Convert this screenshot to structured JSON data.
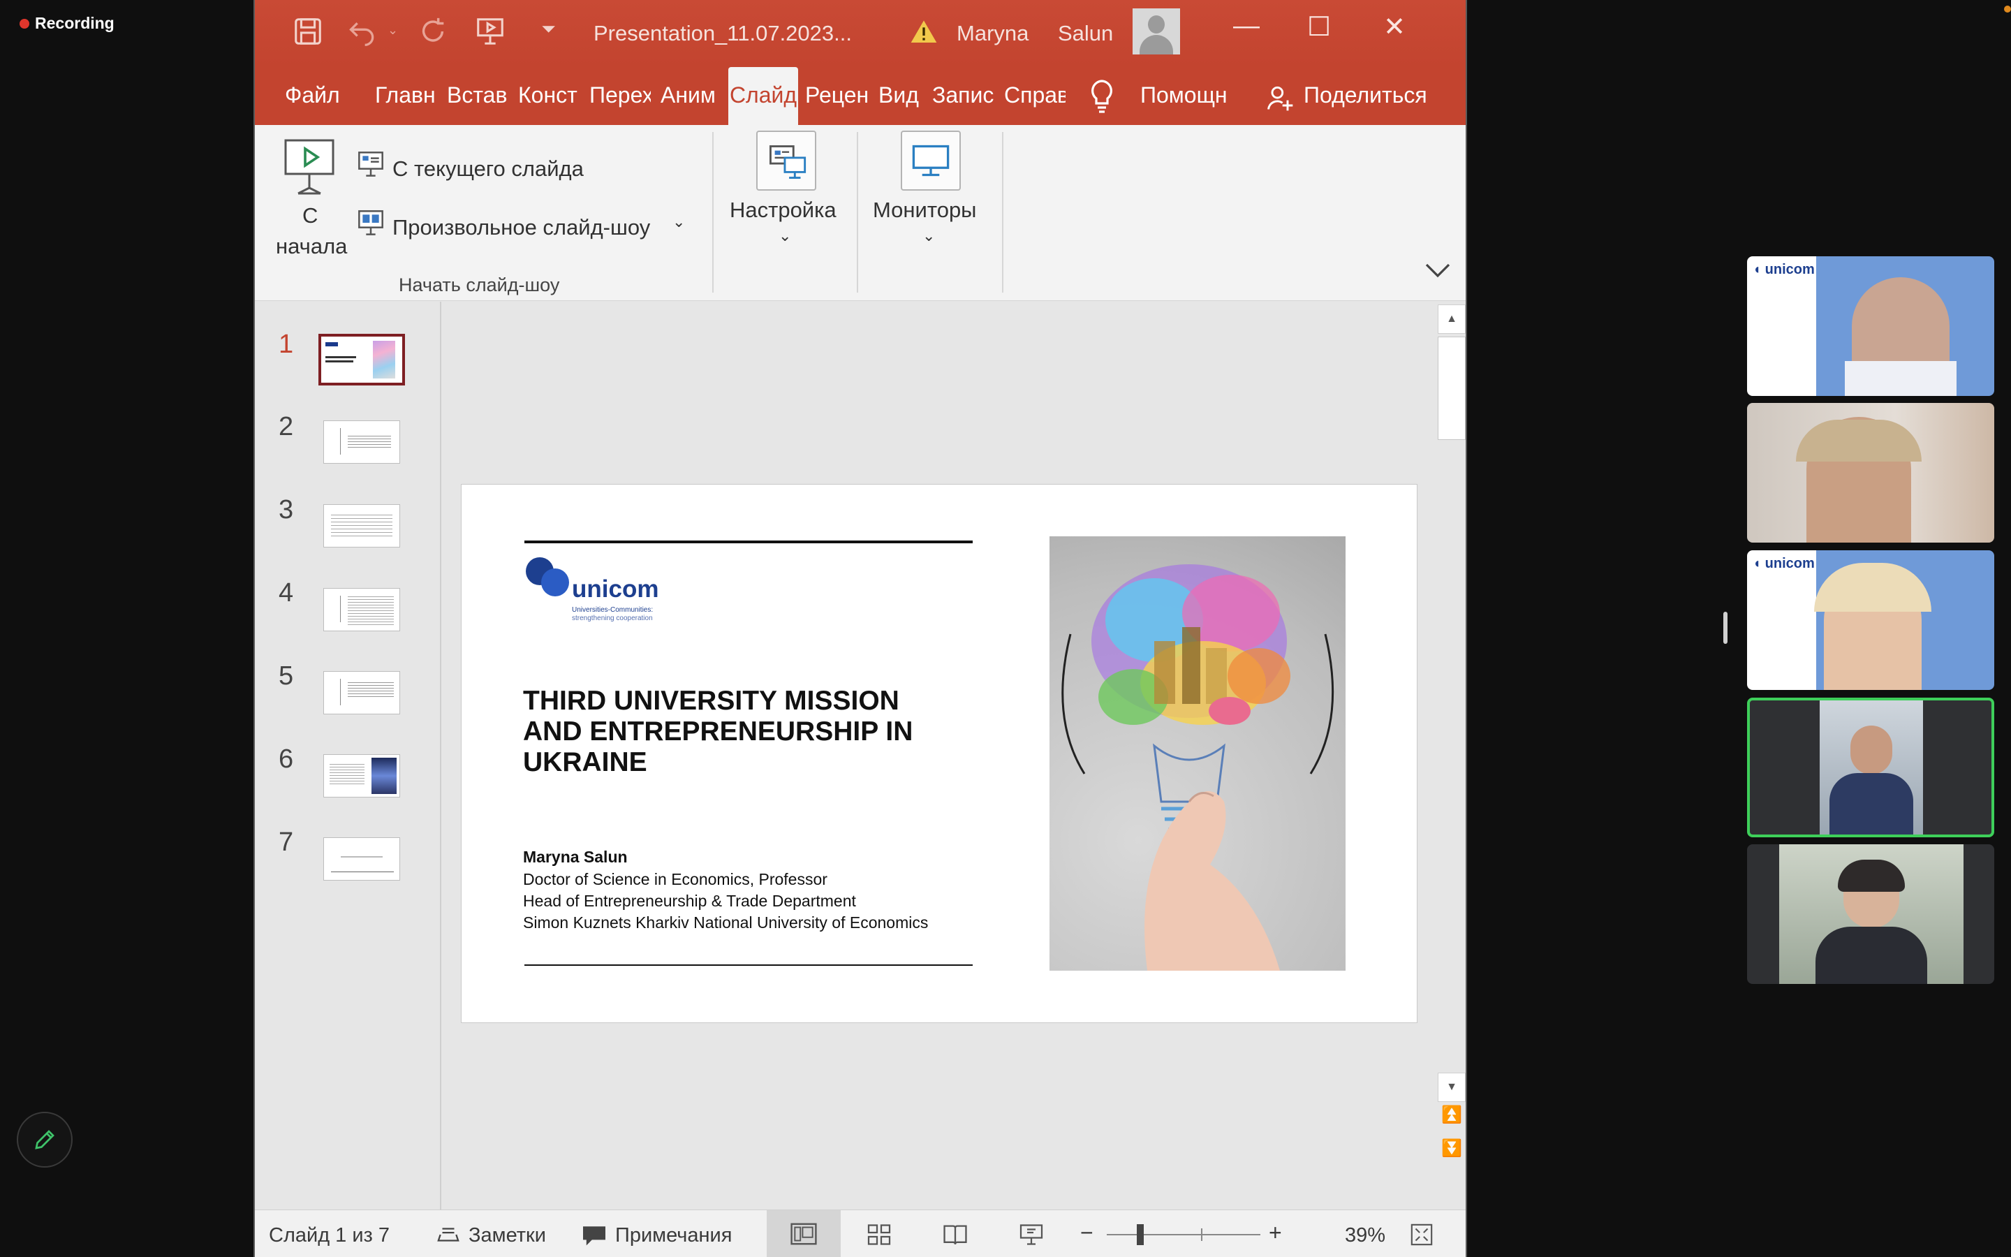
{
  "recording": {
    "label": "Recording"
  },
  "window": {
    "doc_title": "Presentation_11.07.2023...",
    "user_first": "Maryna",
    "user_last": "Salun"
  },
  "tabs": [
    {
      "label": "Файл"
    },
    {
      "label": "Главн"
    },
    {
      "label": "Встав"
    },
    {
      "label": "Конст"
    },
    {
      "label": "Перех"
    },
    {
      "label": "Аним"
    },
    {
      "label": "Слайд",
      "active": true
    },
    {
      "label": "Рецен"
    },
    {
      "label": "Вид"
    },
    {
      "label": "Запис"
    },
    {
      "label": "Справ"
    },
    {
      "label": "Помощн"
    },
    {
      "label": "Поделиться"
    }
  ],
  "ribbon": {
    "from_start_line1": "С",
    "from_start_line2": "начала",
    "from_current": "С текущего слайда",
    "custom_show": "Произвольное слайд-шоу",
    "group_label": "Начать слайд-шоу",
    "setup": "Настройка",
    "monitors": "Мониторы"
  },
  "thumbnails": [
    {
      "num": "1",
      "selected": true
    },
    {
      "num": "2"
    },
    {
      "num": "3"
    },
    {
      "num": "4"
    },
    {
      "num": "5"
    },
    {
      "num": "6"
    },
    {
      "num": "7"
    }
  ],
  "slide": {
    "logo_text": "unicom",
    "logo_sub1": "Universities-Communities:",
    "logo_sub2": "strengthening cooperation",
    "title_line1": "THIRD UNIVERSITY MISSION",
    "title_line2": "AND ENTREPRENEURSHIP IN",
    "title_line3": "UKRAINE",
    "author": "Maryna Salun",
    "line1": "Doctor of Science in Economics, Professor",
    "line2": "Head of Entrepreneurship & Trade Department",
    "line3": "Simon Kuznets Kharkiv National University of Economics"
  },
  "status": {
    "slide_counter": "Слайд 1 из 7",
    "notes": "Заметки",
    "comments": "Примечания",
    "zoom": "39%"
  },
  "participants": [
    {
      "bg": "#5b86c9"
    },
    {
      "bg": "#9b8f86"
    },
    {
      "bg": "#6f93c9"
    },
    {
      "bg": "#3c3d40",
      "speaking": true
    },
    {
      "bg": "#8a9386"
    }
  ]
}
